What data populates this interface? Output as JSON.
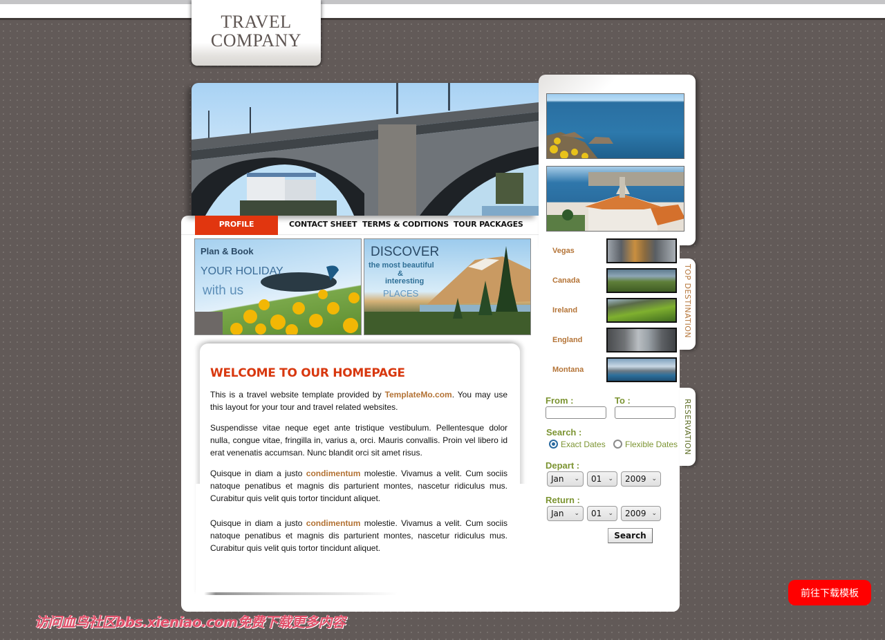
{
  "header": {
    "logo_line1": "TRAVEL",
    "logo_line2": "COMPANY"
  },
  "nav": {
    "items": [
      {
        "label": "PROFILE",
        "active": true
      },
      {
        "label": "CONTACT SHEET",
        "active": false
      },
      {
        "label": "TERMS & CODITIONS",
        "active": false
      },
      {
        "label": "TOUR PACKAGES",
        "active": false
      }
    ]
  },
  "hero": {
    "image": "bridge-photo"
  },
  "banners": [
    {
      "image": "peacock-tulips-photo",
      "line1": "Plan & Book",
      "line2": "YOUR HOLIDAY",
      "line3": "with us"
    },
    {
      "image": "mountain-lake-photo",
      "line1": "DISCOVER",
      "line2": "the most beautiful",
      "line3": "&",
      "line4": "interesting",
      "line5": "PLACES"
    }
  ],
  "welcome": {
    "title": "WELCOME TO OUR HOMEPAGE",
    "p1_before": "This is a travel website template provided by ",
    "p1_link": "TemplateMo.com",
    "p1_after": ". You may use this layout for your tour and travel related websites.",
    "p2": "Suspendisse vitae neque eget ante tristique vestibulum. Pellentesque dolor nulla, congue vitae, fringilla in, varius a, orci. Mauris convallis. Proin vel libero id erat venenatis accumsan. Nunc blandit orci sit amet risus.",
    "p3_before": "Quisque in diam a justo ",
    "p3_highlight": "condimentum",
    "p3_after": " molestie. Vivamus a velit. Cum sociis natoque penatibus et magnis dis parturient montes, nascetur ridiculus mus. Curabitur quis velit quis tortor tincidunt aliquet.",
    "p4_before": "Quisque in diam a justo ",
    "p4_highlight": "condimentum",
    "p4_after": " molestie. Vivamus a velit. Cum sociis natoque penatibus et magnis dis parturient montes, nascetur ridiculus mus. Curabitur quis velit quis tortor tincidunt aliquet."
  },
  "gallery": [
    {
      "image": "coastline-photo"
    },
    {
      "image": "church-seaside-photo"
    }
  ],
  "top_destination": {
    "tab_label": "TOP DESTINATION",
    "items": [
      {
        "name": "Vegas",
        "image": "vegas-lion-photo"
      },
      {
        "name": "Canada",
        "image": "canada-hills-photo"
      },
      {
        "name": "Ireland",
        "image": "ireland-cliff-photo"
      },
      {
        "name": "England",
        "image": "london-bridge-photo"
      },
      {
        "name": "Montana",
        "image": "montana-lake-photo"
      }
    ]
  },
  "reservation": {
    "tab_label": "RESERVATION",
    "from_label": "From :",
    "from_value": "",
    "to_label": "To :",
    "to_value": "",
    "search_label": "Search :",
    "options": [
      {
        "label": "Exact Dates",
        "checked": true
      },
      {
        "label": "Flexible Dates",
        "checked": false
      }
    ],
    "depart_label": "Depart :",
    "depart": {
      "month": "Jan",
      "day": "01",
      "year": "2009"
    },
    "return_label": "Return :",
    "return": {
      "month": "Jan",
      "day": "01",
      "year": "2009"
    },
    "search_button": "Search"
  },
  "watermark": "访问血鸟社区bbs.xieniao.com免费下载更多内容",
  "download_button": "前往下载模板",
  "colors": {
    "accent_red": "#e1360f",
    "title_red": "#d8380f",
    "link_brown": "#b37234",
    "form_green": "#7c9432",
    "download_red": "#ff0000"
  }
}
